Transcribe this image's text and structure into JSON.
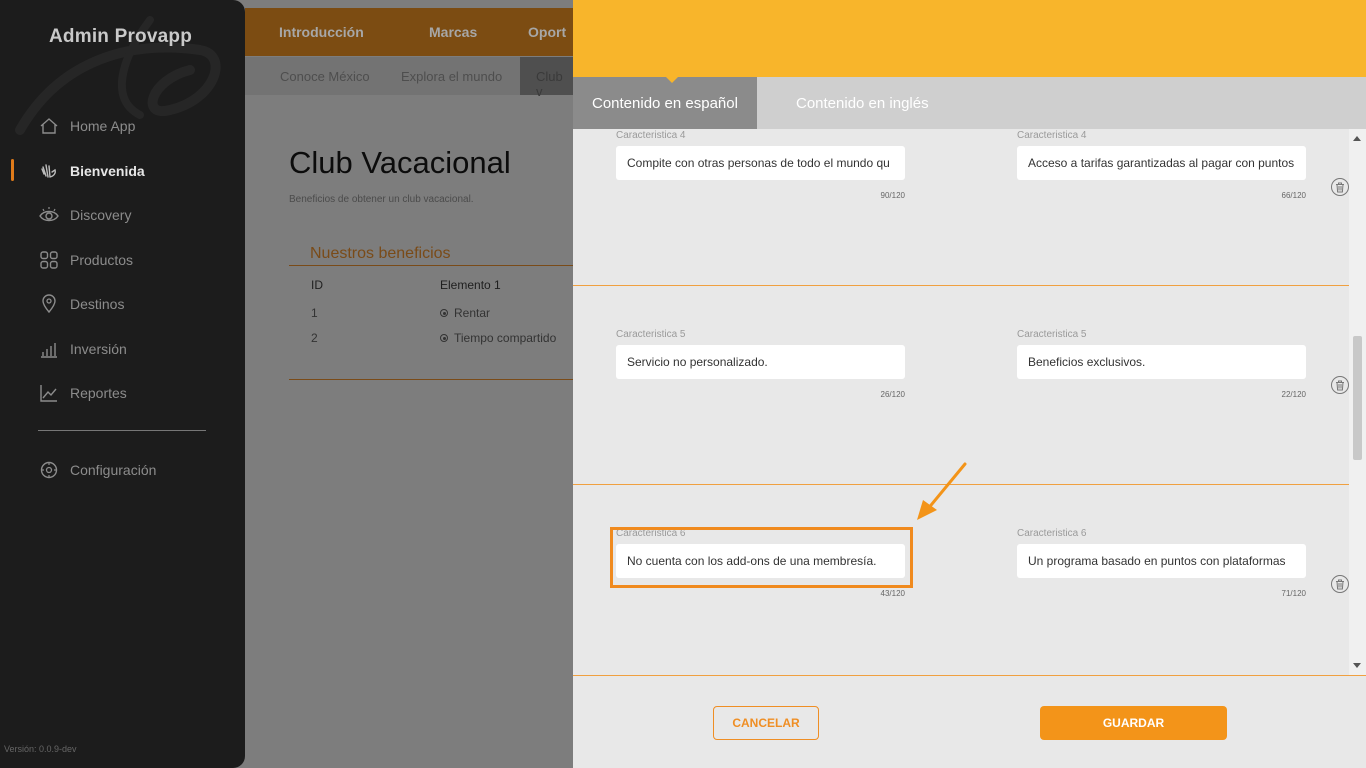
{
  "sidebar": {
    "brand": "Admin Provapp",
    "items": [
      {
        "label": "Home App",
        "icon": "home-icon"
      },
      {
        "label": "Bienvenida",
        "icon": "wave-hand-icon",
        "active": true
      },
      {
        "label": "Discovery",
        "icon": "eye-icon"
      },
      {
        "label": "Productos",
        "icon": "grid-icon"
      },
      {
        "label": "Destinos",
        "icon": "location-pin-icon"
      },
      {
        "label": "Inversión",
        "icon": "bar-chart-icon"
      },
      {
        "label": "Reportes",
        "icon": "line-chart-icon"
      }
    ],
    "config_label": "Configuración",
    "version": "Versión: 0.0.9-dev"
  },
  "topnav": {
    "tabs": [
      "Introducción",
      "Marcas",
      "Oport"
    ]
  },
  "subnav": {
    "tabs": [
      "Conoce México",
      "Explora el mundo",
      "Club v"
    ]
  },
  "main": {
    "title": "Club Vacacional",
    "subtitle": "Beneficios de obtener un club vacacional.",
    "benefits_title": "Nuestros beneficios",
    "table": {
      "headers": [
        "ID",
        "Elemento 1"
      ],
      "rows": [
        {
          "id": "1",
          "value": "Rentar"
        },
        {
          "id": "2",
          "value": "Tiempo compartido"
        }
      ]
    }
  },
  "drawer": {
    "tabs": [
      "Contenido en español",
      "Contenido en inglés"
    ],
    "rows": [
      {
        "es": {
          "label": "Caracteristica 4",
          "value": "Compite con otras personas de todo el mundo qu",
          "count": "90/120"
        },
        "en": {
          "label": "Caracteristica 4",
          "value": "Acceso a tarifas garantizadas al pagar con puntos",
          "count": "66/120"
        }
      },
      {
        "es": {
          "label": "Caracteristica 5",
          "value": "Servicio no personalizado.",
          "count": "26/120"
        },
        "en": {
          "label": "Caracteristica 5",
          "value": "Beneficios exclusivos.",
          "count": "22/120"
        }
      },
      {
        "es": {
          "label": "Caracteristica 6",
          "value": "No cuenta con los add-ons de una membresía.",
          "count": "43/120"
        },
        "en": {
          "label": "Caracteristica 6",
          "value": "Un programa basado en puntos con plataformas",
          "count": "71/120"
        }
      }
    ],
    "cancel_label": "CANCELAR",
    "save_label": "GUARDAR"
  },
  "colors": {
    "accent": "#f8b52b",
    "button": "#f39419",
    "highlight": "#f08a1e"
  }
}
